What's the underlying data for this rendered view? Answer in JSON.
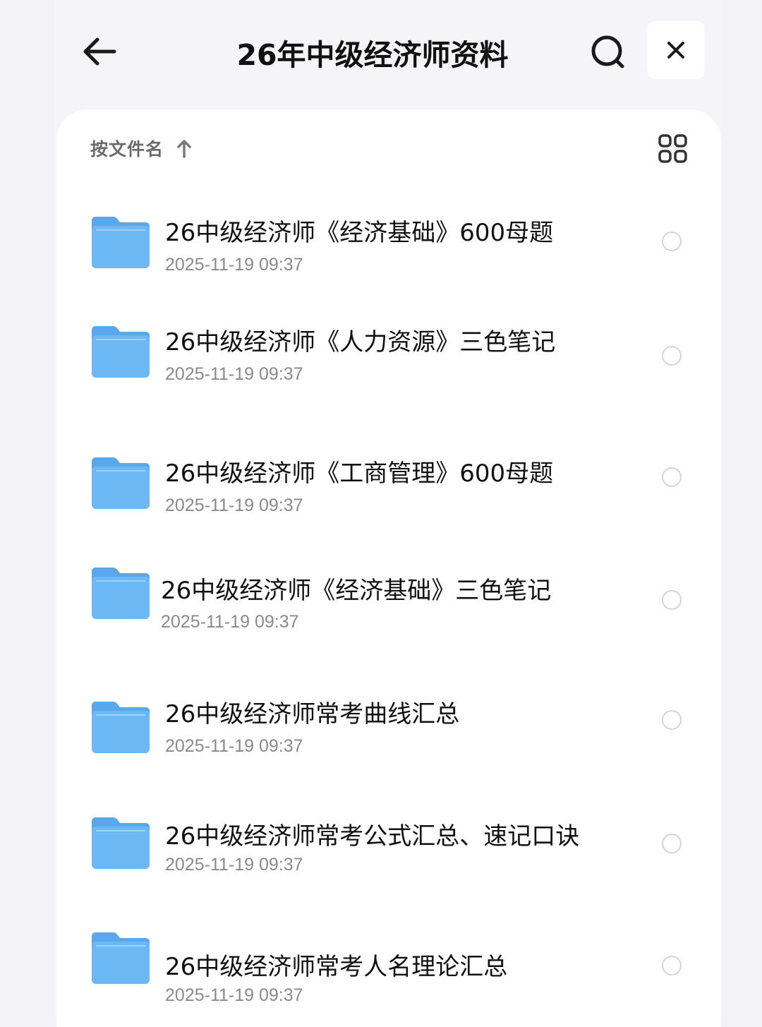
{
  "header": {
    "title": "26年中级经济师资料",
    "back_icon": "arrow-left-icon",
    "search_icon": "search-icon",
    "close_icon": "close-icon"
  },
  "toolbar": {
    "sort_label": "按文件名",
    "sort_icon": "arrow-up-icon",
    "view_icon": "grid-view-icon"
  },
  "files": [
    {
      "name": "26中级经济师《经济基础》600母题",
      "date": "2025-11-19 09:37",
      "type_icon": "folder-icon"
    },
    {
      "name": "26中级经济师《人力资源》三色笔记",
      "date": "2025-11-19 09:37",
      "type_icon": "folder-icon"
    },
    {
      "name": "26中级经济师《工商管理》600母题",
      "date": "2025-11-19 09:37",
      "type_icon": "folder-icon"
    },
    {
      "name": "26中级经济师《经济基础》三色笔记",
      "date": "2025-11-19 09:37",
      "type_icon": "folder-icon"
    },
    {
      "name": "26中级经济师常考曲线汇总",
      "date": "2025-11-19 09:37",
      "type_icon": "folder-icon"
    },
    {
      "name": "26中级经济师常考公式汇总、速记口诀",
      "date": "2025-11-19 09:37",
      "type_icon": "folder-icon"
    },
    {
      "name": "26中级经济师常考人名理论汇总",
      "date": "2025-11-19 09:37",
      "type_icon": "folder-icon"
    }
  ],
  "colors": {
    "folder": "#6cb8f5",
    "folder_tab": "#5aa8ec",
    "background": "#f5f5f7",
    "text": "#111111",
    "subtext": "#8a8a8a"
  }
}
